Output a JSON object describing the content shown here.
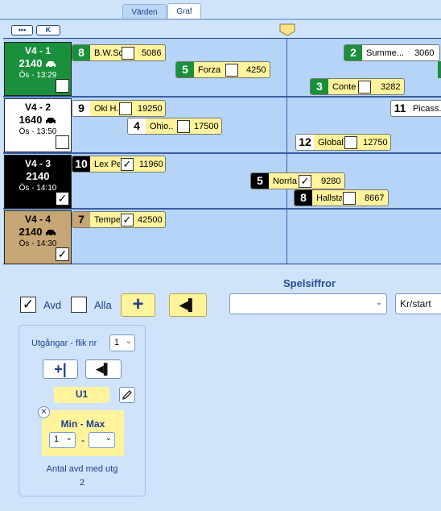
{
  "tabs": [
    {
      "label": "Värden"
    },
    {
      "label": "Graf"
    }
  ],
  "toolbar": {
    "more_label": "•••",
    "k_label": "K"
  },
  "races": [
    {
      "name": "V4 - 1",
      "distance": "2140",
      "start_time": "Ös - 13:29",
      "checked": false,
      "color": "#1a8f3c"
    },
    {
      "name": "V4 - 2",
      "distance": "1640",
      "start_time": "Ös - 13:50",
      "checked": false,
      "color": "#ffffff"
    },
    {
      "name": "V4 - 3",
      "distance": "2140",
      "start_time": "Ös - 14:10",
      "checked": true,
      "color": "#000000"
    },
    {
      "name": "V4 - 4",
      "distance": "2140",
      "start_time": "Ös - 14:30",
      "checked": true,
      "color": "#c7a676"
    }
  ],
  "horses": {
    "r1": [
      {
        "number": "8",
        "name": "B.W.Sc",
        "checked": false,
        "value": "5086"
      },
      {
        "number": "5",
        "name": "Forza",
        "checked": false,
        "value": "4250"
      },
      {
        "number": "2",
        "name": "Summe...",
        "value": "3060"
      },
      {
        "number": "3",
        "name": "Conte",
        "checked": false,
        "value": "3282"
      }
    ],
    "r2": [
      {
        "number": "9",
        "name": "Oki H..",
        "checked": false,
        "value": "19250"
      },
      {
        "number": "4",
        "name": "Ohio..",
        "checked": false,
        "value": "17500"
      },
      {
        "number": "11",
        "name": "Picass..."
      },
      {
        "number": "12",
        "name": "Global",
        "checked": false,
        "value": "12750"
      }
    ],
    "r3": [
      {
        "number": "10",
        "name": "Lex Pe",
        "checked": true,
        "value": "11960"
      },
      {
        "number": "5",
        "name": "Norrla",
        "checked": true,
        "value": "9280"
      },
      {
        "number": "8",
        "name": "Hallsta",
        "checked": false,
        "value": "8667"
      }
    ],
    "r4": [
      {
        "number": "7",
        "name": "Tempe",
        "checked": true,
        "value": "42500"
      }
    ]
  },
  "bottom": {
    "spelsiffror_label": "Spelsiffror",
    "avd_label": "Avd",
    "avd_checked": true,
    "alla_label": "Alla",
    "alla_checked": false,
    "plus_label": "+",
    "play_back_label": "◀▌",
    "game_select_value": "",
    "unit_select_value": "Kr/start"
  },
  "panel": {
    "title": "Utgångar - flik nr",
    "tab_number": "1",
    "add_label": "+|",
    "back_label": "◀▌",
    "u1_label": "U1",
    "minmax_label": "Min - Max",
    "min_value": "1",
    "separator": "-",
    "max_value": "",
    "count_label": "Antal avd med utg",
    "count_value": "2"
  },
  "icons": [
    "car-icon",
    "checkmark-icon",
    "pencil-icon",
    "close-icon",
    "chevron-down-icon",
    "marker-icon"
  ]
}
